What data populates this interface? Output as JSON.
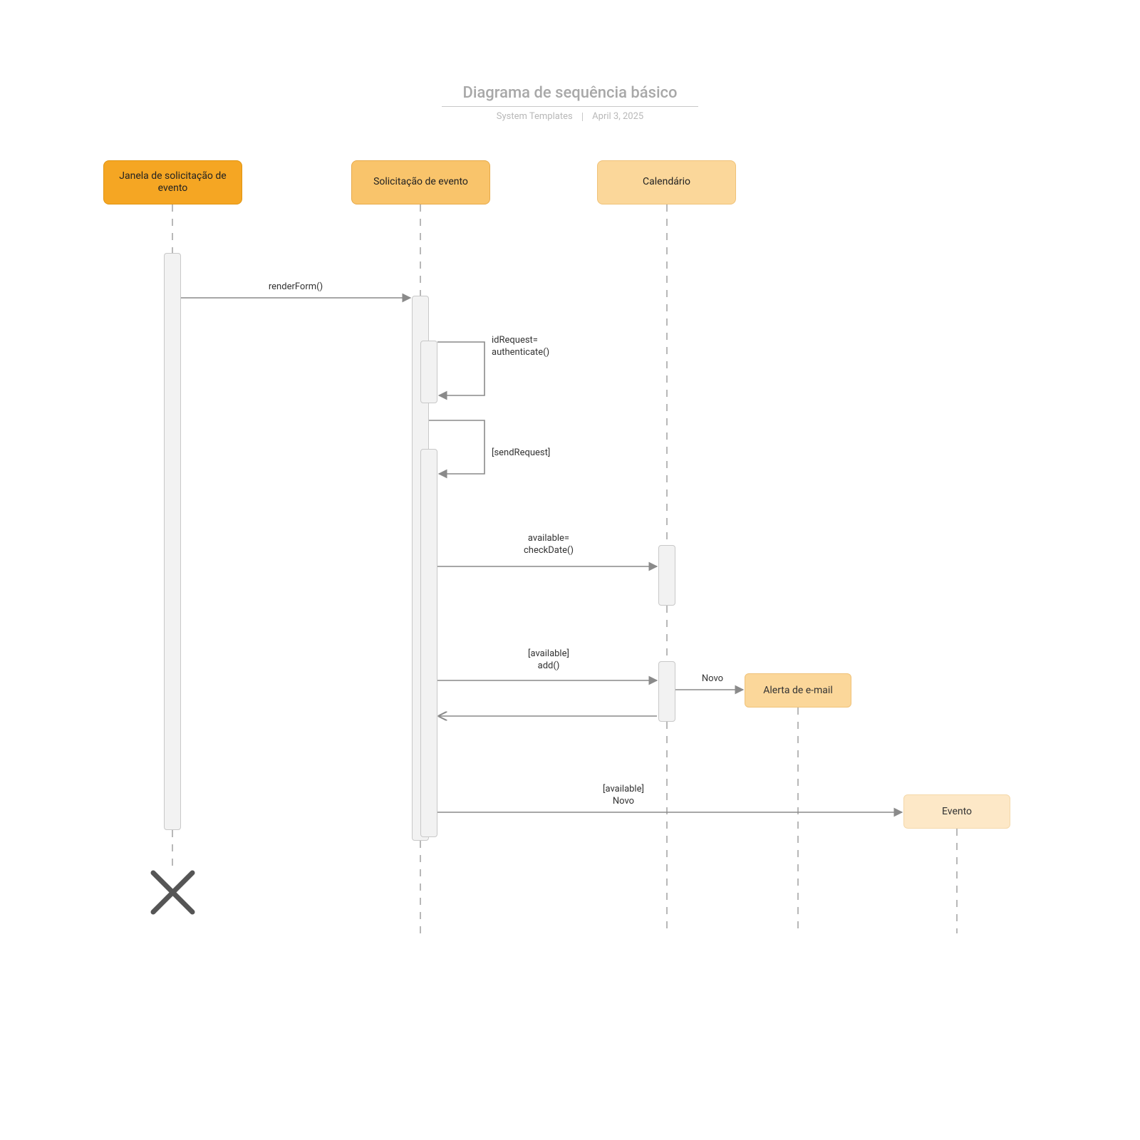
{
  "title": "Diagrama de sequência básico",
  "subtitle_left": "System Templates",
  "subtitle_right": "April 3, 2025",
  "participants": {
    "p1": "Janela de solicitação de\nevento",
    "p2": "Solicitação de evento",
    "p3": "Calendário"
  },
  "created": {
    "email_alert": "Alerta de e-mail",
    "event": "Evento"
  },
  "messages": {
    "renderForm": "renderForm()",
    "authenticate": "idRequest=\nauthenticate()",
    "sendRequest": "[sendRequest]",
    "checkDate": "available=\ncheckDate()",
    "add": "[available]\nadd()",
    "novo1": "Novo",
    "availableNovo": "[available]\nNovo"
  }
}
